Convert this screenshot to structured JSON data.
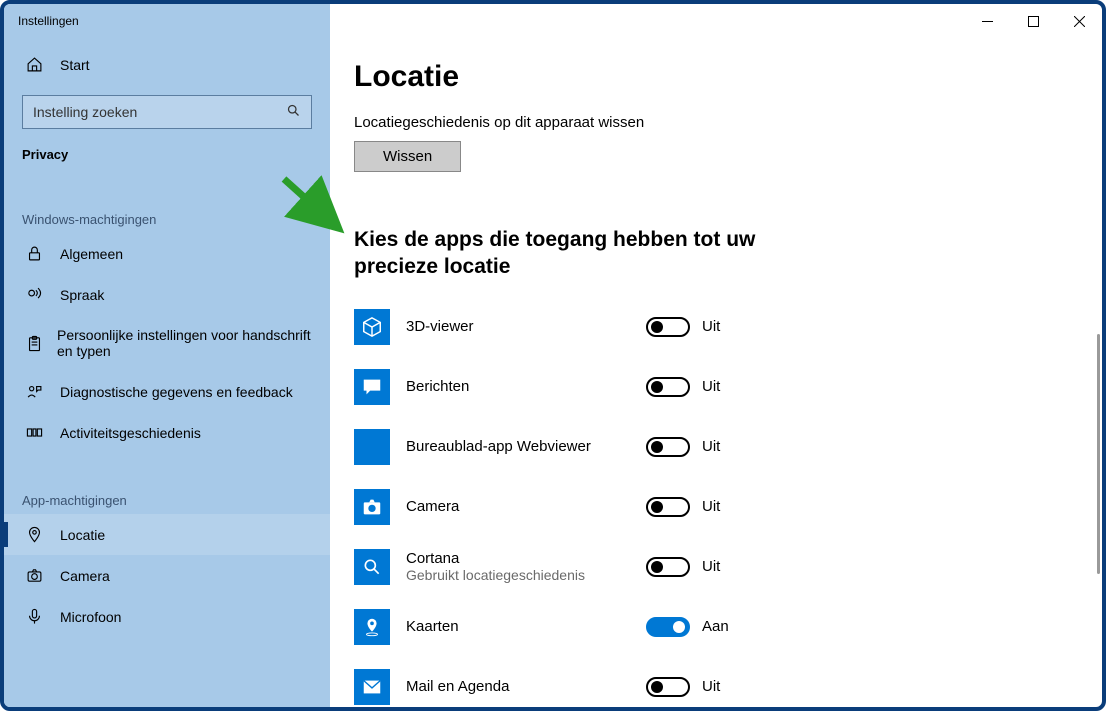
{
  "window": {
    "title": "Instellingen"
  },
  "sidebar": {
    "home_label": "Start",
    "search_placeholder": "Instelling zoeken",
    "category_label": "Privacy",
    "group_windows": "Windows-machtigingen",
    "group_apps": "App-machtigingen",
    "winItems": [
      {
        "icon": "lock",
        "label": "Algemeen"
      },
      {
        "icon": "speech",
        "label": "Spraak"
      },
      {
        "icon": "clipboard",
        "label": "Persoonlijke instellingen voor handschrift en typen"
      },
      {
        "icon": "feedback",
        "label": "Diagnostische gegevens en feedback"
      },
      {
        "icon": "activity",
        "label": "Activiteitsgeschiedenis"
      }
    ],
    "appItems": [
      {
        "icon": "location",
        "label": "Locatie",
        "selected": true
      },
      {
        "icon": "camera",
        "label": "Camera"
      },
      {
        "icon": "mic",
        "label": "Microfoon"
      }
    ]
  },
  "main": {
    "title": "Locatie",
    "history_label": "Locatiegeschiedenis op dit apparaat wissen",
    "clear_button": "Wissen",
    "section_heading": "Kies de apps die toegang hebben tot uw precieze locatie",
    "state_on": "Aan",
    "state_off": "Uit",
    "apps": [
      {
        "name": "3D-viewer",
        "sub": "",
        "on": false,
        "icon": "cube"
      },
      {
        "name": "Berichten",
        "sub": "",
        "on": false,
        "icon": "message"
      },
      {
        "name": "Bureaublad-app Webviewer",
        "sub": "",
        "on": false,
        "icon": "blank"
      },
      {
        "name": "Camera",
        "sub": "",
        "on": false,
        "icon": "camera-fill"
      },
      {
        "name": "Cortana",
        "sub": "Gebruikt locatiegeschiedenis",
        "on": false,
        "icon": "search"
      },
      {
        "name": "Kaarten",
        "sub": "",
        "on": true,
        "icon": "maps"
      },
      {
        "name": "Mail en Agenda",
        "sub": "",
        "on": false,
        "icon": "mail"
      }
    ]
  }
}
